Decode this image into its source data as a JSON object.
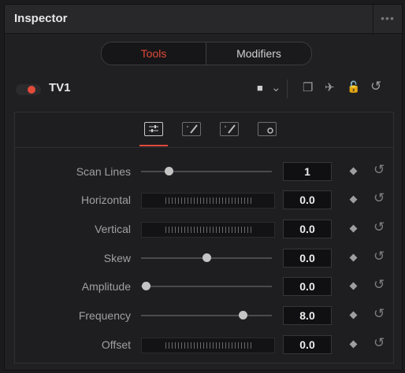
{
  "panel": {
    "title": "Inspector",
    "menu_icon": "more-dots-icon",
    "menu_glyph": "•••"
  },
  "tabs": {
    "tools": "Tools",
    "modifiers": "Modifiers",
    "active": "Tools"
  },
  "node": {
    "name": "TV1",
    "enabled": true,
    "icons": [
      "color-swatch-icon",
      "chevron-down-icon",
      "versions-icon",
      "pin-icon",
      "lock-icon",
      "reset-icon"
    ],
    "glyphs": {
      "swatch": "■",
      "chevron": "⌄",
      "versions": "❒",
      "pin": "✈",
      "lock": "🔓",
      "reset": "↺"
    }
  },
  "icon_tabs": [
    "controls-tab-icon",
    "edit-mask-icon",
    "edit-mask-alt-icon",
    "settings-tab-icon"
  ],
  "params": [
    {
      "label": "Scan Lines",
      "value": "1",
      "control": "slider",
      "slider_fraction": 0.2
    },
    {
      "label": "Horizontal",
      "value": "0.0",
      "control": "thumbwheel"
    },
    {
      "label": "Vertical",
      "value": "0.0",
      "control": "thumbwheel"
    },
    {
      "label": "Skew",
      "value": "0.0",
      "control": "slider",
      "slider_fraction": 0.5
    },
    {
      "label": "Amplitude",
      "value": "0.0",
      "control": "slider",
      "slider_fraction": 0.0
    },
    {
      "label": "Frequency",
      "value": "8.0",
      "control": "slider",
      "slider_fraction": 0.8
    },
    {
      "label": "Offset",
      "value": "0.0",
      "control": "thumbwheel"
    }
  ],
  "row_glyphs": {
    "keyframe": "◆",
    "reset": "↺"
  },
  "colors": {
    "accent": "#e24a3a",
    "background": "#202023"
  }
}
